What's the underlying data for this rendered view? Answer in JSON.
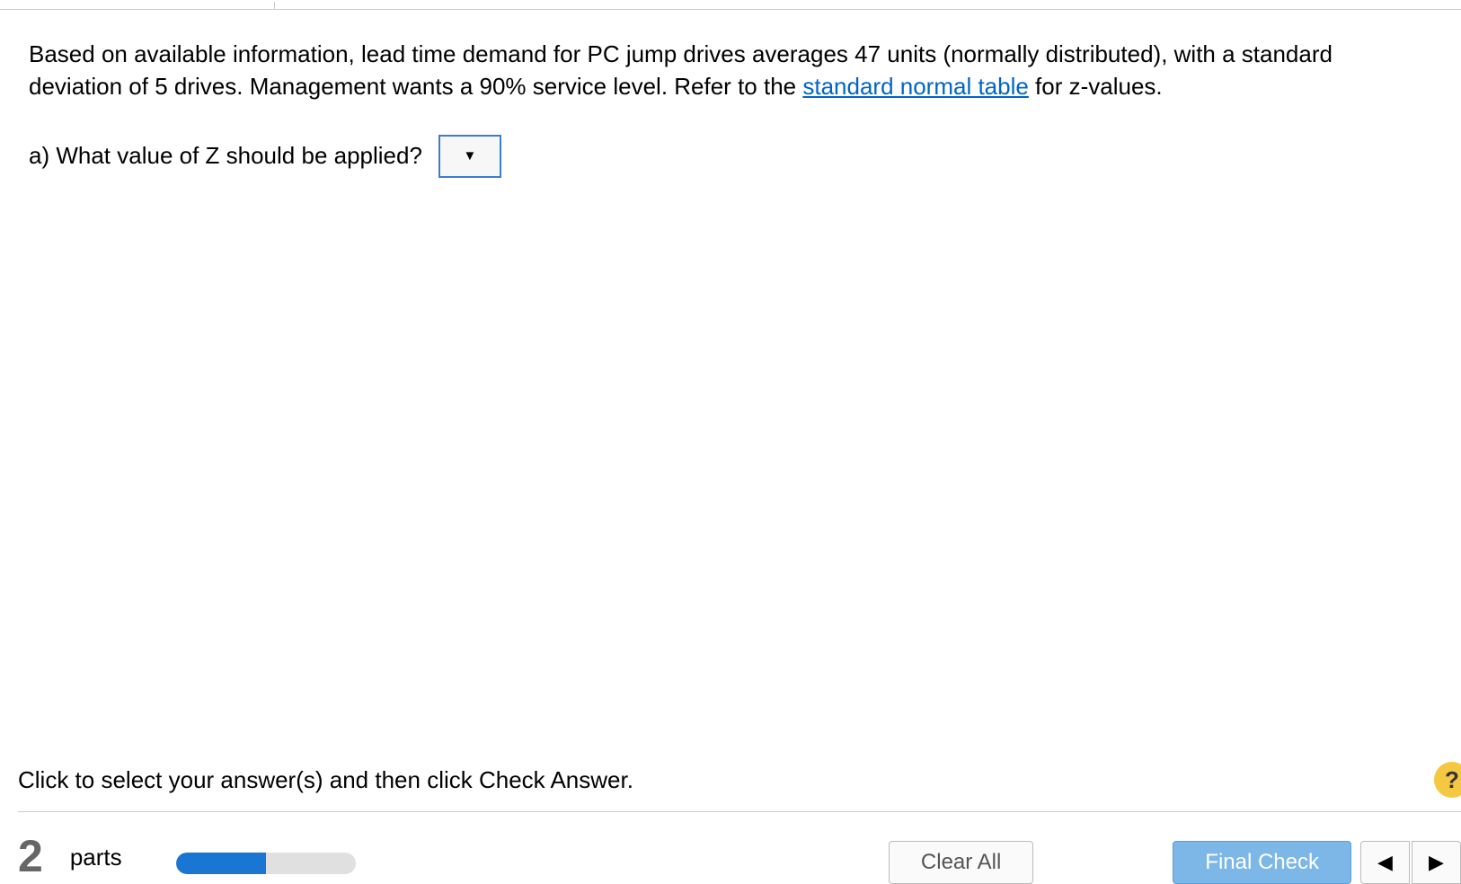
{
  "problem": {
    "intro_before_link": "Based on available information, lead time demand for PC jump drives averages 47 units (normally distributed), with a standard deviation of 5 drives. Management wants a 90% service level. Refer to the ",
    "link_text": "standard normal table",
    "intro_after_link": " for z-values.",
    "part_a": "a) What value of Z should be applied?"
  },
  "instruction": "Click to select your answer(s) and then click Check Answer.",
  "footer": {
    "parts_count": "2",
    "parts_label": "parts",
    "clear_all": "Clear All",
    "final_check": "Final Check"
  },
  "icons": {
    "dropdown": "▼",
    "help": "?",
    "prev": "◀",
    "next": "▶"
  }
}
